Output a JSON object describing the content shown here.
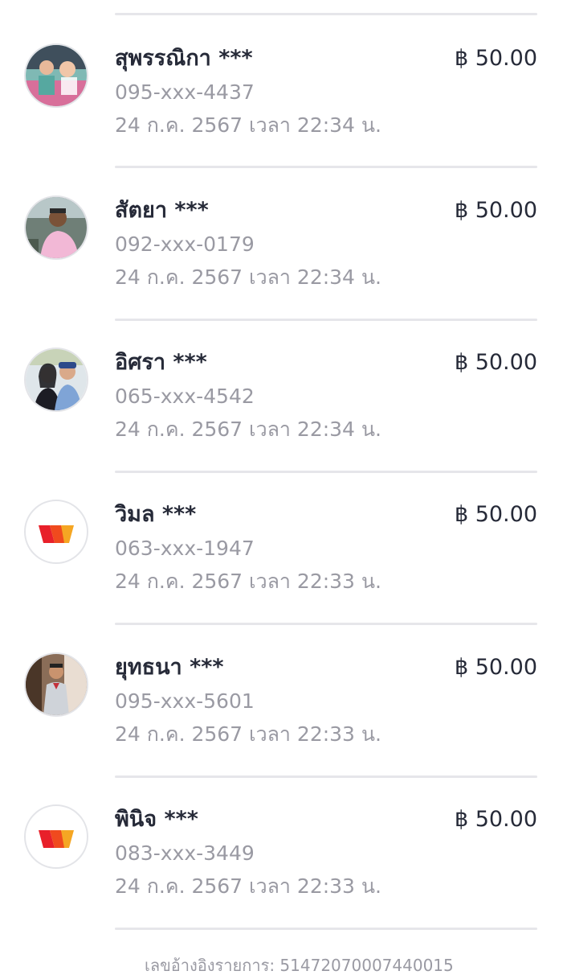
{
  "transactions": [
    {
      "name": "สุพรรณิกา ***",
      "phone": "095-xxx-4437",
      "datetime": "24 ก.ค. 2567 เวลา 22:34 น.",
      "amount": "฿ 50.00",
      "avatar": "photo"
    },
    {
      "name": "สัตยา ***",
      "phone": "092-xxx-0179",
      "datetime": "24 ก.ค. 2567 เวลา 22:34 น.",
      "amount": "฿ 50.00",
      "avatar": "photo"
    },
    {
      "name": "อิศรา ***",
      "phone": "065-xxx-4542",
      "datetime": "24 ก.ค. 2567 เวลา 22:34 น.",
      "amount": "฿ 50.00",
      "avatar": "photo"
    },
    {
      "name": "วิมล ***",
      "phone": "063-xxx-1947",
      "datetime": "24 ก.ค. 2567 เวลา 22:33 น.",
      "amount": "฿ 50.00",
      "avatar": "truemoney-logo"
    },
    {
      "name": "ยุทธนา ***",
      "phone": "095-xxx-5601",
      "datetime": "24 ก.ค. 2567 เวลา 22:33 น.",
      "amount": "฿ 50.00",
      "avatar": "photo"
    },
    {
      "name": "พินิจ ***",
      "phone": "083-xxx-3449",
      "datetime": "24 ก.ค. 2567 เวลา 22:33 น.",
      "amount": "฿ 50.00",
      "avatar": "truemoney-logo"
    }
  ],
  "footer": {
    "text": "เลขอ้างอิงรายการ: 51472070007440015"
  },
  "colors": {
    "name_text": "#262a38",
    "secondary_text": "#9a9aa3",
    "divider": "#e6e6ea",
    "logo_red": "#e8202a",
    "logo_orange": "#f5a623"
  }
}
